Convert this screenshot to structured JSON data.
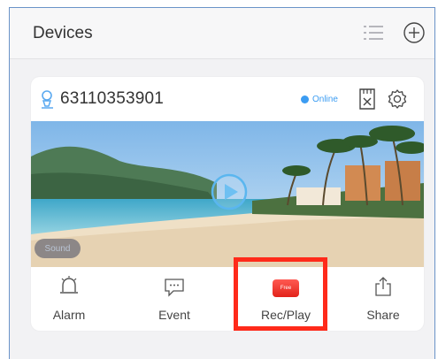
{
  "header": {
    "title": "Devices",
    "icons": [
      "list-icon",
      "add-icon"
    ]
  },
  "device": {
    "id": "63110353901",
    "status": "Online",
    "status_color": "#3b9cf2",
    "icons": [
      "device-icon",
      "sd-card-icon",
      "gear-icon"
    ]
  },
  "preview": {
    "sound_label": "Sound"
  },
  "actions": [
    {
      "label": "Alarm",
      "icon": "alarm-bell-icon"
    },
    {
      "label": "Event",
      "icon": "message-icon"
    },
    {
      "label": "Rec/Play",
      "icon": "rec-play-icon",
      "badge": "Free"
    },
    {
      "label": "Share",
      "icon": "share-icon"
    }
  ],
  "colors": {
    "highlight": "#ff2a1a",
    "accent": "#3b9cf2"
  }
}
